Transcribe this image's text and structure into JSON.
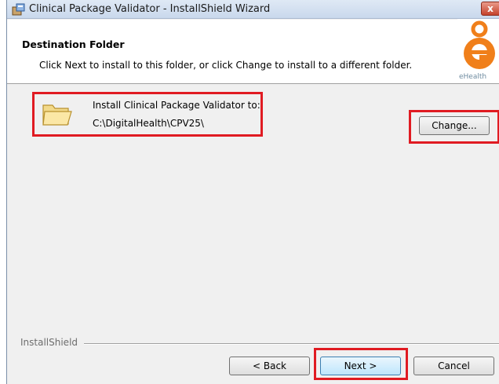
{
  "window": {
    "title": "Clinical Package Validator - InstallShield Wizard",
    "close_label": "x",
    "title_icon": "installer-icon"
  },
  "header": {
    "title": "Destination Folder",
    "description": "Click Next to install to this folder, or click Change to install to a different folder.",
    "logo_caption": "eHealth",
    "logo_color": "#f07f1a"
  },
  "destination": {
    "label": "Install Clinical Package Validator to:",
    "path": "C:\\DigitalHealth\\CPV25\\",
    "icon": "folder-icon",
    "change_label": "Change..."
  },
  "footer": {
    "brand": "InstallShield",
    "back_label": "< Back",
    "next_label": "Next >",
    "cancel_label": "Cancel"
  },
  "colors": {
    "highlight": "#e01b22",
    "dialog_bg": "#f0f0f0"
  }
}
